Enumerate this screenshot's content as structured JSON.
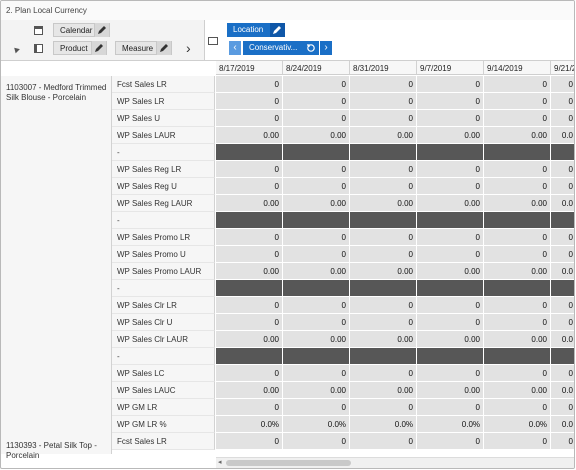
{
  "window": {
    "title": "2. Plan Local Currency"
  },
  "dimensions": {
    "calendar": "Calendar",
    "product": "Product",
    "measure": "Measure",
    "location": "Location",
    "scenario": "Conservativ..."
  },
  "columns": [
    "8/17/2019",
    "8/24/2019",
    "8/31/2019",
    "9/7/2019",
    "9/14/2019",
    "9/21/2"
  ],
  "products": [
    {
      "name": "1103007 - Medford Trimmed Silk Blouse - Porcelain"
    },
    {
      "name": "1130393 - Petal Silk Top - Porcelain"
    }
  ],
  "rows": [
    {
      "measure": "Fcst Sales LR",
      "values": [
        "0",
        "0",
        "0",
        "0",
        "0",
        "0"
      ]
    },
    {
      "measure": "WP Sales LR",
      "values": [
        "0",
        "0",
        "0",
        "0",
        "0",
        "0"
      ]
    },
    {
      "measure": "WP Sales U",
      "values": [
        "0",
        "0",
        "0",
        "0",
        "0",
        "0"
      ]
    },
    {
      "measure": "WP Sales LAUR",
      "values": [
        "0.00",
        "0.00",
        "0.00",
        "0.00",
        "0.00",
        "0.0"
      ]
    },
    {
      "measure": "-",
      "separator": true
    },
    {
      "measure": "WP Sales Reg LR",
      "values": [
        "0",
        "0",
        "0",
        "0",
        "0",
        "0"
      ]
    },
    {
      "measure": "WP Sales Reg U",
      "values": [
        "0",
        "0",
        "0",
        "0",
        "0",
        "0"
      ]
    },
    {
      "measure": "WP Sales Reg LAUR",
      "values": [
        "0.00",
        "0.00",
        "0.00",
        "0.00",
        "0.00",
        "0.0"
      ]
    },
    {
      "measure": "-",
      "separator": true
    },
    {
      "measure": "WP Sales Promo LR",
      "values": [
        "0",
        "0",
        "0",
        "0",
        "0",
        "0"
      ]
    },
    {
      "measure": "WP Sales Promo U",
      "values": [
        "0",
        "0",
        "0",
        "0",
        "0",
        "0"
      ]
    },
    {
      "measure": "WP Sales Promo LAUR",
      "values": [
        "0.00",
        "0.00",
        "0.00",
        "0.00",
        "0.00",
        "0.0"
      ]
    },
    {
      "measure": "-",
      "separator": true
    },
    {
      "measure": "WP Sales Clr LR",
      "values": [
        "0",
        "0",
        "0",
        "0",
        "0",
        "0"
      ]
    },
    {
      "measure": "WP Sales Clr U",
      "values": [
        "0",
        "0",
        "0",
        "0",
        "0",
        "0"
      ]
    },
    {
      "measure": "WP Sales Clr LAUR",
      "values": [
        "0.00",
        "0.00",
        "0.00",
        "0.00",
        "0.00",
        "0.0"
      ]
    },
    {
      "measure": "-",
      "separator": true
    },
    {
      "measure": "WP Sales LC",
      "values": [
        "0",
        "0",
        "0",
        "0",
        "0",
        "0"
      ]
    },
    {
      "measure": "WP Sales LAUC",
      "values": [
        "0.00",
        "0.00",
        "0.00",
        "0.00",
        "0.00",
        "0.0"
      ]
    },
    {
      "measure": "WP GM LR",
      "values": [
        "0",
        "0",
        "0",
        "0",
        "0",
        "0"
      ]
    },
    {
      "measure": "WP GM LR %",
      "values": [
        "0.0%",
        "0.0%",
        "0.0%",
        "0.0%",
        "0.0%",
        "0.0"
      ]
    },
    {
      "measure": "Fcst Sales LR",
      "values": [
        "0",
        "0",
        "0",
        "0",
        "0",
        "0"
      ]
    }
  ]
}
